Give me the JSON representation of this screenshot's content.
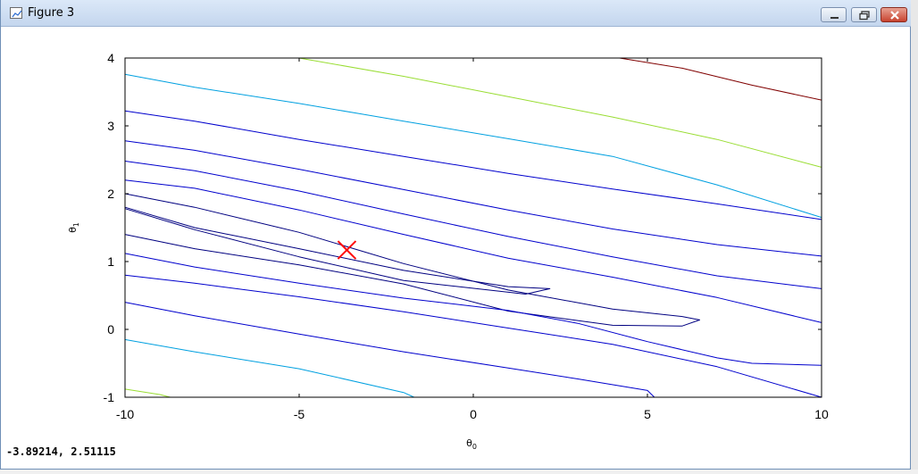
{
  "window": {
    "title": "Figure 3",
    "status_readout": "-3.89214, 2.51115"
  },
  "colors": {
    "frame": "#000000",
    "marker": "#ff0000",
    "level_colors": [
      "#000080",
      "#0000cd",
      "#00a0e0",
      "#99dd33",
      "#800000"
    ]
  },
  "chart_data": {
    "type": "contour",
    "title": "",
    "xlabel": "θ0",
    "ylabel": "θ1",
    "xlim": [
      -10,
      10
    ],
    "ylim": [
      -1,
      4
    ],
    "xticks": [
      "-10",
      "-5",
      "0",
      "5",
      "10"
    ],
    "yticks": [
      "4",
      "3",
      "2",
      "1",
      "0",
      "-1"
    ],
    "grid": false,
    "legend": "none",
    "marker": {
      "symbol": "x",
      "x": -3.63,
      "y": 1.17
    },
    "contours": [
      {
        "level": 1,
        "color": "#000080",
        "points": [
          [
            -10,
            1.8
          ],
          [
            -8,
            1.5
          ],
          [
            -5,
            1.19
          ],
          [
            -2,
            0.87
          ],
          [
            1,
            0.63
          ],
          [
            2.2,
            0.6
          ],
          [
            1.5,
            0.52
          ],
          [
            -2,
            0.72
          ],
          [
            -5,
            1.07
          ],
          [
            -8,
            1.47
          ],
          [
            -10,
            1.78
          ]
        ]
      },
      {
        "level": 2,
        "color": "#000080",
        "points": [
          [
            -10,
            2.0
          ],
          [
            -8,
            1.8
          ],
          [
            -5,
            1.43
          ],
          [
            -2,
            0.97
          ],
          [
            1,
            0.58
          ],
          [
            4,
            0.3
          ],
          [
            6,
            0.19
          ],
          [
            6.5,
            0.14
          ],
          [
            6,
            0.05
          ],
          [
            4,
            0.06
          ],
          [
            1,
            0.27
          ],
          [
            -2,
            0.67
          ],
          [
            -5,
            0.95
          ],
          [
            -8,
            1.19
          ],
          [
            -10,
            1.4
          ]
        ]
      },
      {
        "level": 3,
        "color": "#0000cd",
        "points": [
          [
            -10,
            2.2
          ],
          [
            -8,
            2.08
          ],
          [
            -5,
            1.76
          ],
          [
            -2,
            1.4
          ],
          [
            1,
            1.05
          ],
          [
            4,
            0.77
          ],
          [
            7,
            0.47
          ],
          [
            10,
            0.1
          ]
        ]
      },
      {
        "level": 3,
        "color": "#0000cd",
        "points": [
          [
            -10,
            1.12
          ],
          [
            -8,
            0.92
          ],
          [
            -5,
            0.68
          ],
          [
            -2,
            0.46
          ],
          [
            1,
            0.28
          ],
          [
            3,
            0.09
          ],
          [
            5,
            -0.18
          ],
          [
            7,
            -0.42
          ],
          [
            8,
            -0.5
          ],
          [
            10,
            -0.53
          ]
        ]
      },
      {
        "level": 4,
        "color": "#0000cd",
        "points": [
          [
            -10,
            2.48
          ],
          [
            -8,
            2.34
          ],
          [
            -5,
            2.04
          ],
          [
            -2,
            1.7
          ],
          [
            1,
            1.37
          ],
          [
            4,
            1.07
          ],
          [
            7,
            0.79
          ],
          [
            10,
            0.6
          ]
        ]
      },
      {
        "level": 4,
        "color": "#0000cd",
        "points": [
          [
            -10,
            0.8
          ],
          [
            -8,
            0.68
          ],
          [
            -5,
            0.48
          ],
          [
            -2,
            0.26
          ],
          [
            1,
            0.02
          ],
          [
            4,
            -0.22
          ],
          [
            7,
            -0.55
          ],
          [
            10,
            -1.0
          ]
        ]
      },
      {
        "level": 5,
        "color": "#0000cd",
        "points": [
          [
            -10,
            2.78
          ],
          [
            -8,
            2.64
          ],
          [
            -5,
            2.36
          ],
          [
            -2,
            2.06
          ],
          [
            1,
            1.76
          ],
          [
            4,
            1.48
          ],
          [
            7,
            1.25
          ],
          [
            10,
            1.08
          ]
        ]
      },
      {
        "level": 5,
        "color": "#0000cd",
        "points": [
          [
            -10,
            0.4
          ],
          [
            -8,
            0.2
          ],
          [
            -5,
            -0.07
          ],
          [
            -2,
            -0.33
          ],
          [
            1,
            -0.57
          ],
          [
            3,
            -0.73
          ],
          [
            5,
            -0.9
          ],
          [
            5.2,
            -1.0
          ]
        ]
      },
      {
        "level": 6,
        "color": "#0000cd",
        "points": [
          [
            -10,
            3.22
          ],
          [
            -8,
            3.07
          ],
          [
            -5,
            2.8
          ],
          [
            -2,
            2.55
          ],
          [
            1,
            2.3
          ],
          [
            4,
            2.07
          ],
          [
            7,
            1.85
          ],
          [
            10,
            1.62
          ]
        ]
      },
      {
        "level": 7,
        "color": "#00a0e0",
        "points": [
          [
            -10,
            3.76
          ],
          [
            -8,
            3.57
          ],
          [
            -5,
            3.33
          ],
          [
            -2,
            3.07
          ],
          [
            1,
            2.81
          ],
          [
            4,
            2.55
          ],
          [
            7,
            2.13
          ],
          [
            10,
            1.65
          ]
        ]
      },
      {
        "level": 7,
        "color": "#00a0e0",
        "points": [
          [
            -10,
            -0.15
          ],
          [
            -8,
            -0.33
          ],
          [
            -5,
            -0.58
          ],
          [
            -2,
            -0.93
          ],
          [
            -1.7,
            -1.0
          ]
        ]
      },
      {
        "level": 8,
        "color": "#99dd33",
        "points": [
          [
            -5,
            4.0
          ],
          [
            -2,
            3.73
          ],
          [
            1,
            3.43
          ],
          [
            4,
            3.13
          ],
          [
            7,
            2.8
          ],
          [
            10,
            2.39
          ]
        ]
      },
      {
        "level": 8,
        "color": "#99dd33",
        "points": [
          [
            -10,
            -0.88
          ],
          [
            -9,
            -0.96
          ],
          [
            -8.7,
            -1.0
          ]
        ]
      },
      {
        "level": 9,
        "color": "#800000",
        "points": [
          [
            4.2,
            4.0
          ],
          [
            6,
            3.85
          ],
          [
            8,
            3.6
          ],
          [
            10,
            3.38
          ]
        ]
      }
    ]
  }
}
